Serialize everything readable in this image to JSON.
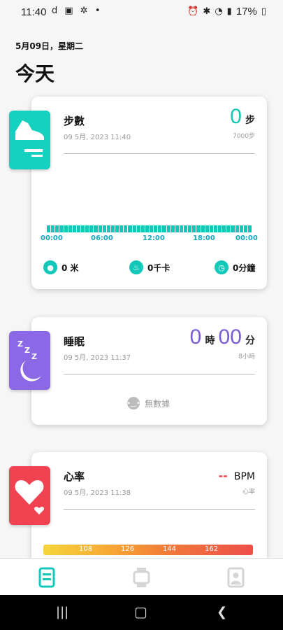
{
  "status_bar": {
    "time": "11:40",
    "left_icons": "d ▣ ✲ •",
    "battery": "17%"
  },
  "header": {
    "date": "5月09日，星期二",
    "title": "今天"
  },
  "steps_card": {
    "title": "步數",
    "timestamp": "09 5月, 2023 11:40",
    "value": "0",
    "unit": "步",
    "goal": "7000步",
    "axis_labels": [
      "00:00",
      "06:00",
      "12:00",
      "18:00",
      "00:00"
    ],
    "distance": "0 米",
    "calories": "0千卡",
    "duration": "0分鐘",
    "accent": "#12c8b9"
  },
  "sleep_card": {
    "title": "睡眠",
    "timestamp": "09 5月, 2023 11:37",
    "hours": "0",
    "hours_unit": "時",
    "minutes": "00",
    "minutes_unit": "分",
    "goal": "8小時",
    "no_data": "無數據",
    "accent": "#7e5bd6"
  },
  "heart_card": {
    "title": "心率",
    "timestamp": "09 5月, 2023 11:38",
    "value": "--",
    "unit": "BPM",
    "sub": "心率",
    "zones": [
      "108",
      "126",
      "144",
      "162"
    ],
    "accent": "#ee3f4a"
  },
  "bottom_nav": {
    "items": [
      "dashboard-icon",
      "watch-icon",
      "profile-icon"
    ],
    "active_color": "#12c8b9"
  }
}
